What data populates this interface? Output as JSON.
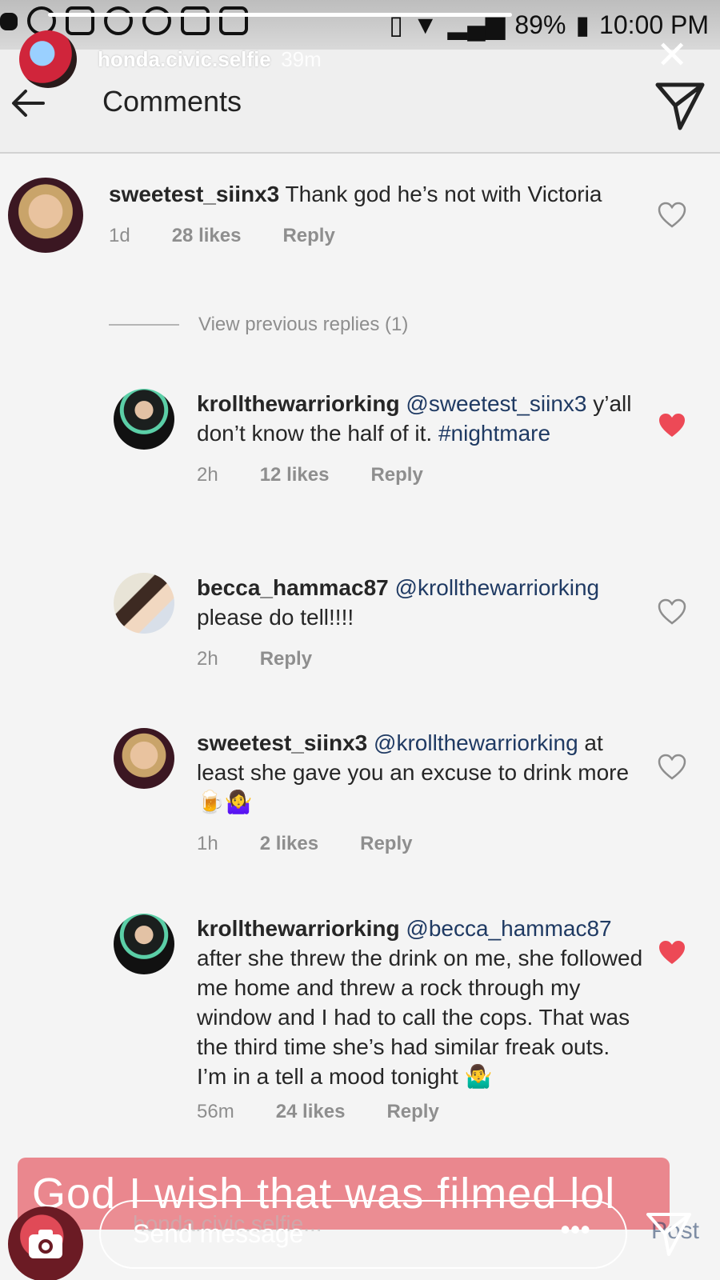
{
  "status_bar": {
    "battery": "89%",
    "time": "10:00 PM"
  },
  "story": {
    "username": "honda.civic.selfie",
    "time_ago": "39m"
  },
  "header": {
    "title": "Comments"
  },
  "comments": [
    {
      "username": "sweetest_siinx3",
      "text": " Thank god he’s not with Victoria",
      "time": "1d",
      "likes": "28 likes",
      "reply": "Reply",
      "liked": false
    },
    {
      "username": "krollthewarriorking",
      "mention": " @sweetest_siinx3",
      "text": " y’all don’t know the half of it. ",
      "hashtag": "#nightmare",
      "time": "2h",
      "likes": "12 likes",
      "reply": "Reply",
      "liked": true
    },
    {
      "username": "becca_hammac87",
      "mention": " @krollthewarriorking",
      "text": " please do tell!!!!",
      "time": "2h",
      "reply": "Reply",
      "liked": false
    },
    {
      "username": "sweetest_siinx3",
      "mention": " @krollthewarriorking",
      "text": " at least she gave you an excuse to drink more 🍺🤷‍♀️",
      "time": "1h",
      "likes": "2 likes",
      "reply": "Reply",
      "liked": false
    },
    {
      "username": "krollthewarriorking",
      "mention": " @becca_hammac87",
      "text": " after she threw the drink on me, she followed me home and threw a rock through my window and I had to call the cops. That was the third time she’s had similar freak outs. I’m in a tell a mood tonight 🤷‍♂️",
      "time": "56m",
      "likes": "24 likes",
      "reply": "Reply",
      "liked": true
    }
  ],
  "view_previous_replies": "View previous replies (1)",
  "caption": "God I wish that was filmed lol",
  "bottom": {
    "send_message_placeholder": "Send message",
    "ghost_text": "honda.civic.selfie...",
    "more": "•••",
    "post_ghost": "Post"
  },
  "colors": {
    "heart_liked": "#ed4956",
    "mention": "#1f3a63",
    "caption_bg": "#e87880"
  }
}
